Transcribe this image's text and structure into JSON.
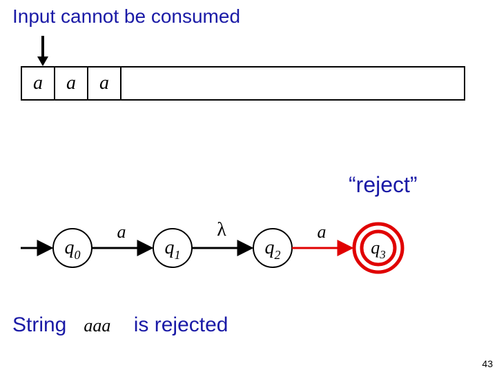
{
  "title": "Input cannot be consumed",
  "tape": {
    "cells": [
      "a",
      "a",
      "a"
    ]
  },
  "reject_label": "“reject”",
  "fsm": {
    "states": [
      {
        "name": "q",
        "sub": "0"
      },
      {
        "name": "q",
        "sub": "1"
      },
      {
        "name": "q",
        "sub": "2"
      },
      {
        "name": "q",
        "sub": "3"
      }
    ],
    "transitions": [
      {
        "label": "a"
      },
      {
        "label": "λ"
      },
      {
        "label": "a"
      }
    ]
  },
  "bottom": {
    "prefix": "String",
    "string": "aaa",
    "suffix": "is rejected"
  },
  "slide_number": "43"
}
